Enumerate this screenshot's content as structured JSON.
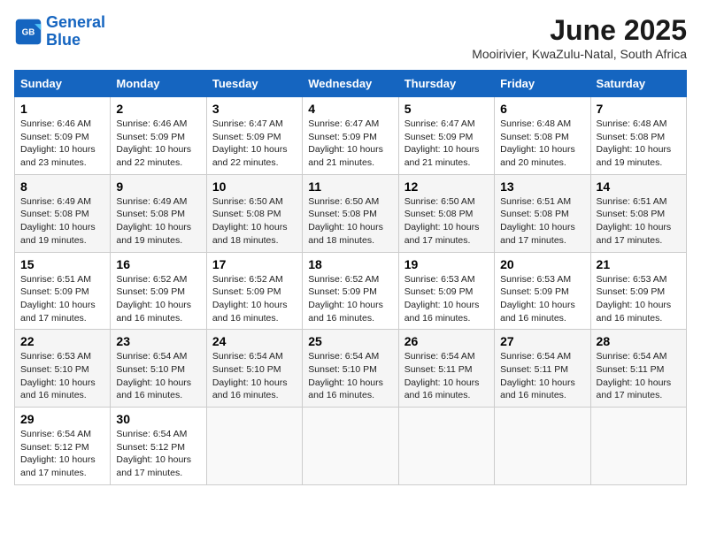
{
  "logo": {
    "line1": "General",
    "line2": "Blue"
  },
  "title": "June 2025",
  "subtitle": "Mooirivier, KwaZulu-Natal, South Africa",
  "weekdays": [
    "Sunday",
    "Monday",
    "Tuesday",
    "Wednesday",
    "Thursday",
    "Friday",
    "Saturday"
  ],
  "weeks": [
    [
      {
        "day": "1",
        "info": "Sunrise: 6:46 AM\nSunset: 5:09 PM\nDaylight: 10 hours\nand 23 minutes."
      },
      {
        "day": "2",
        "info": "Sunrise: 6:46 AM\nSunset: 5:09 PM\nDaylight: 10 hours\nand 22 minutes."
      },
      {
        "day": "3",
        "info": "Sunrise: 6:47 AM\nSunset: 5:09 PM\nDaylight: 10 hours\nand 22 minutes."
      },
      {
        "day": "4",
        "info": "Sunrise: 6:47 AM\nSunset: 5:09 PM\nDaylight: 10 hours\nand 21 minutes."
      },
      {
        "day": "5",
        "info": "Sunrise: 6:47 AM\nSunset: 5:09 PM\nDaylight: 10 hours\nand 21 minutes."
      },
      {
        "day": "6",
        "info": "Sunrise: 6:48 AM\nSunset: 5:08 PM\nDaylight: 10 hours\nand 20 minutes."
      },
      {
        "day": "7",
        "info": "Sunrise: 6:48 AM\nSunset: 5:08 PM\nDaylight: 10 hours\nand 19 minutes."
      }
    ],
    [
      {
        "day": "8",
        "info": "Sunrise: 6:49 AM\nSunset: 5:08 PM\nDaylight: 10 hours\nand 19 minutes."
      },
      {
        "day": "9",
        "info": "Sunrise: 6:49 AM\nSunset: 5:08 PM\nDaylight: 10 hours\nand 19 minutes."
      },
      {
        "day": "10",
        "info": "Sunrise: 6:50 AM\nSunset: 5:08 PM\nDaylight: 10 hours\nand 18 minutes."
      },
      {
        "day": "11",
        "info": "Sunrise: 6:50 AM\nSunset: 5:08 PM\nDaylight: 10 hours\nand 18 minutes."
      },
      {
        "day": "12",
        "info": "Sunrise: 6:50 AM\nSunset: 5:08 PM\nDaylight: 10 hours\nand 17 minutes."
      },
      {
        "day": "13",
        "info": "Sunrise: 6:51 AM\nSunset: 5:08 PM\nDaylight: 10 hours\nand 17 minutes."
      },
      {
        "day": "14",
        "info": "Sunrise: 6:51 AM\nSunset: 5:08 PM\nDaylight: 10 hours\nand 17 minutes."
      }
    ],
    [
      {
        "day": "15",
        "info": "Sunrise: 6:51 AM\nSunset: 5:09 PM\nDaylight: 10 hours\nand 17 minutes."
      },
      {
        "day": "16",
        "info": "Sunrise: 6:52 AM\nSunset: 5:09 PM\nDaylight: 10 hours\nand 16 minutes."
      },
      {
        "day": "17",
        "info": "Sunrise: 6:52 AM\nSunset: 5:09 PM\nDaylight: 10 hours\nand 16 minutes."
      },
      {
        "day": "18",
        "info": "Sunrise: 6:52 AM\nSunset: 5:09 PM\nDaylight: 10 hours\nand 16 minutes."
      },
      {
        "day": "19",
        "info": "Sunrise: 6:53 AM\nSunset: 5:09 PM\nDaylight: 10 hours\nand 16 minutes."
      },
      {
        "day": "20",
        "info": "Sunrise: 6:53 AM\nSunset: 5:09 PM\nDaylight: 10 hours\nand 16 minutes."
      },
      {
        "day": "21",
        "info": "Sunrise: 6:53 AM\nSunset: 5:09 PM\nDaylight: 10 hours\nand 16 minutes."
      }
    ],
    [
      {
        "day": "22",
        "info": "Sunrise: 6:53 AM\nSunset: 5:10 PM\nDaylight: 10 hours\nand 16 minutes."
      },
      {
        "day": "23",
        "info": "Sunrise: 6:54 AM\nSunset: 5:10 PM\nDaylight: 10 hours\nand 16 minutes."
      },
      {
        "day": "24",
        "info": "Sunrise: 6:54 AM\nSunset: 5:10 PM\nDaylight: 10 hours\nand 16 minutes."
      },
      {
        "day": "25",
        "info": "Sunrise: 6:54 AM\nSunset: 5:10 PM\nDaylight: 10 hours\nand 16 minutes."
      },
      {
        "day": "26",
        "info": "Sunrise: 6:54 AM\nSunset: 5:11 PM\nDaylight: 10 hours\nand 16 minutes."
      },
      {
        "day": "27",
        "info": "Sunrise: 6:54 AM\nSunset: 5:11 PM\nDaylight: 10 hours\nand 16 minutes."
      },
      {
        "day": "28",
        "info": "Sunrise: 6:54 AM\nSunset: 5:11 PM\nDaylight: 10 hours\nand 17 minutes."
      }
    ],
    [
      {
        "day": "29",
        "info": "Sunrise: 6:54 AM\nSunset: 5:12 PM\nDaylight: 10 hours\nand 17 minutes."
      },
      {
        "day": "30",
        "info": "Sunrise: 6:54 AM\nSunset: 5:12 PM\nDaylight: 10 hours\nand 17 minutes."
      },
      {
        "day": "",
        "info": ""
      },
      {
        "day": "",
        "info": ""
      },
      {
        "day": "",
        "info": ""
      },
      {
        "day": "",
        "info": ""
      },
      {
        "day": "",
        "info": ""
      }
    ]
  ]
}
